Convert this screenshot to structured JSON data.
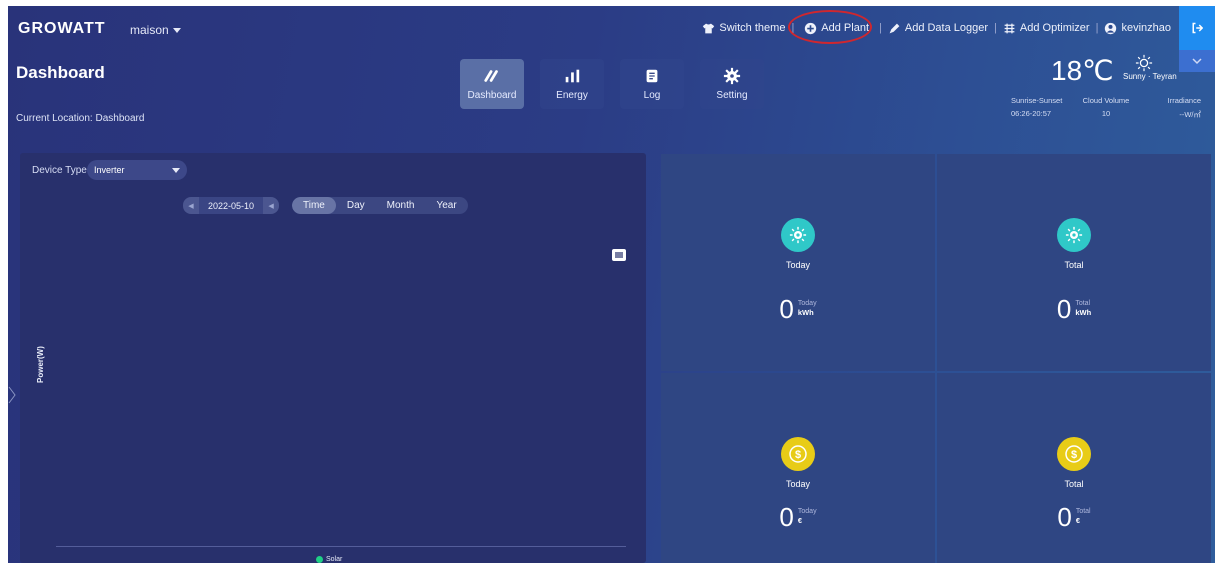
{
  "brand": {
    "logo": "GROWATT",
    "plant": "maison"
  },
  "top_actions": {
    "switch_theme": "Switch theme",
    "add_plant": "Add Plant",
    "add_logger": "Add Data Logger",
    "add_optimizer": "Add Optimizer",
    "user": "kevinzhao"
  },
  "page": {
    "title": "Dashboard",
    "location": "Current Location: Dashboard"
  },
  "nav": [
    {
      "label": "Dashboard",
      "icon": "gauge-icon",
      "active": true
    },
    {
      "label": "Energy",
      "icon": "bar-chart-icon",
      "active": false
    },
    {
      "label": "Log",
      "icon": "log-icon",
      "active": false
    },
    {
      "label": "Setting",
      "icon": "gear-icon",
      "active": false
    }
  ],
  "weather": {
    "temperature": "18℃",
    "condition": "Sunny · Teyran",
    "labels": [
      "Sunrise-Sunset",
      "Cloud Volume",
      "Irradiance"
    ],
    "values": [
      "06:26-20:57",
      "10",
      "--W/㎡"
    ]
  },
  "chart": {
    "device_type_label": "Device Type",
    "device_type": "Inverter",
    "date": "2022-05-10",
    "periods": [
      "Time",
      "Day",
      "Month",
      "Year"
    ],
    "active_period": "Time",
    "y_label": "Power(W)",
    "legend": "Solar",
    "legend_color": "#1fcf86"
  },
  "chart_data": {
    "type": "line",
    "ylabel": "Power(W)",
    "series": [
      {
        "name": "Solar",
        "values": []
      }
    ]
  },
  "cards": [
    {
      "label": "Today",
      "value": "0",
      "unit_top": "Today",
      "unit_bottom": "kWh",
      "icon": "solar-icon"
    },
    {
      "label": "Total",
      "value": "0",
      "unit_top": "Total",
      "unit_bottom": "kWh",
      "icon": "solar-icon"
    },
    {
      "label": "Today",
      "value": "0",
      "unit_top": "Today",
      "unit_bottom": "€",
      "icon": "dollar-coin-icon"
    },
    {
      "label": "Total",
      "value": "0",
      "unit_top": "Total",
      "unit_bottom": "€",
      "icon": "dollar-coin-icon"
    }
  ],
  "colors": {
    "accent": "#1f8cf0",
    "teal": "#2fc8c8",
    "gold": "#e8cc17",
    "highlight_ring": "#d0272e"
  }
}
